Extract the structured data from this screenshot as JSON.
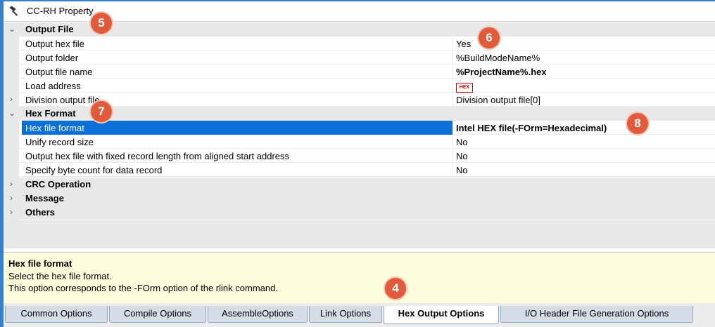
{
  "window": {
    "title": "CC-RH Property",
    "icon": "hammer-icon"
  },
  "groups": [
    {
      "label": "Output File",
      "expanded": true,
      "items": [
        {
          "name": "Output hex file",
          "value": "Yes"
        },
        {
          "name": "Output folder",
          "value": "%BuildModeName%"
        },
        {
          "name": "Output file name",
          "value": "%ProjectName%.hex"
        },
        {
          "name": "Load address",
          "value": "",
          "value_icon": "hex-icon",
          "icon_text": "HEX"
        },
        {
          "name": "Division output file",
          "value": "Division output file[0]",
          "expandable": true
        }
      ]
    },
    {
      "label": "Hex Format",
      "expanded": true,
      "items": [
        {
          "name": "Hex file format",
          "value": "Intel HEX file(-FOrm=Hexadecimal)",
          "selected": true
        },
        {
          "name": "Unify record size",
          "value": "No"
        },
        {
          "name": "Output hex file with fixed record length from aligned start address",
          "value": "No"
        },
        {
          "name": "Specify byte count for data record",
          "value": "No"
        }
      ]
    },
    {
      "label": "CRC Operation",
      "expanded": false
    },
    {
      "label": "Message",
      "expanded": false
    },
    {
      "label": "Others",
      "expanded": false
    }
  ],
  "description": {
    "title": "Hex file format",
    "line1": "Select the hex file format.",
    "line2": "This option corresponds to the -FOrm option of the rlink command."
  },
  "tabs": [
    {
      "label": "Common Options"
    },
    {
      "label": "Compile Options"
    },
    {
      "label": "AssembleOptions"
    },
    {
      "label": "Link Options"
    },
    {
      "label": "Hex Output Options",
      "active": true
    },
    {
      "label": "I/O Header File Generation Options"
    }
  ],
  "callouts": [
    "5",
    "6",
    "7",
    "8",
    "4"
  ],
  "colors": {
    "selection": "#0a6fd6",
    "callout": "#e05a3c",
    "description_bg": "#fdfcdc",
    "frame": "#3a7fce"
  }
}
